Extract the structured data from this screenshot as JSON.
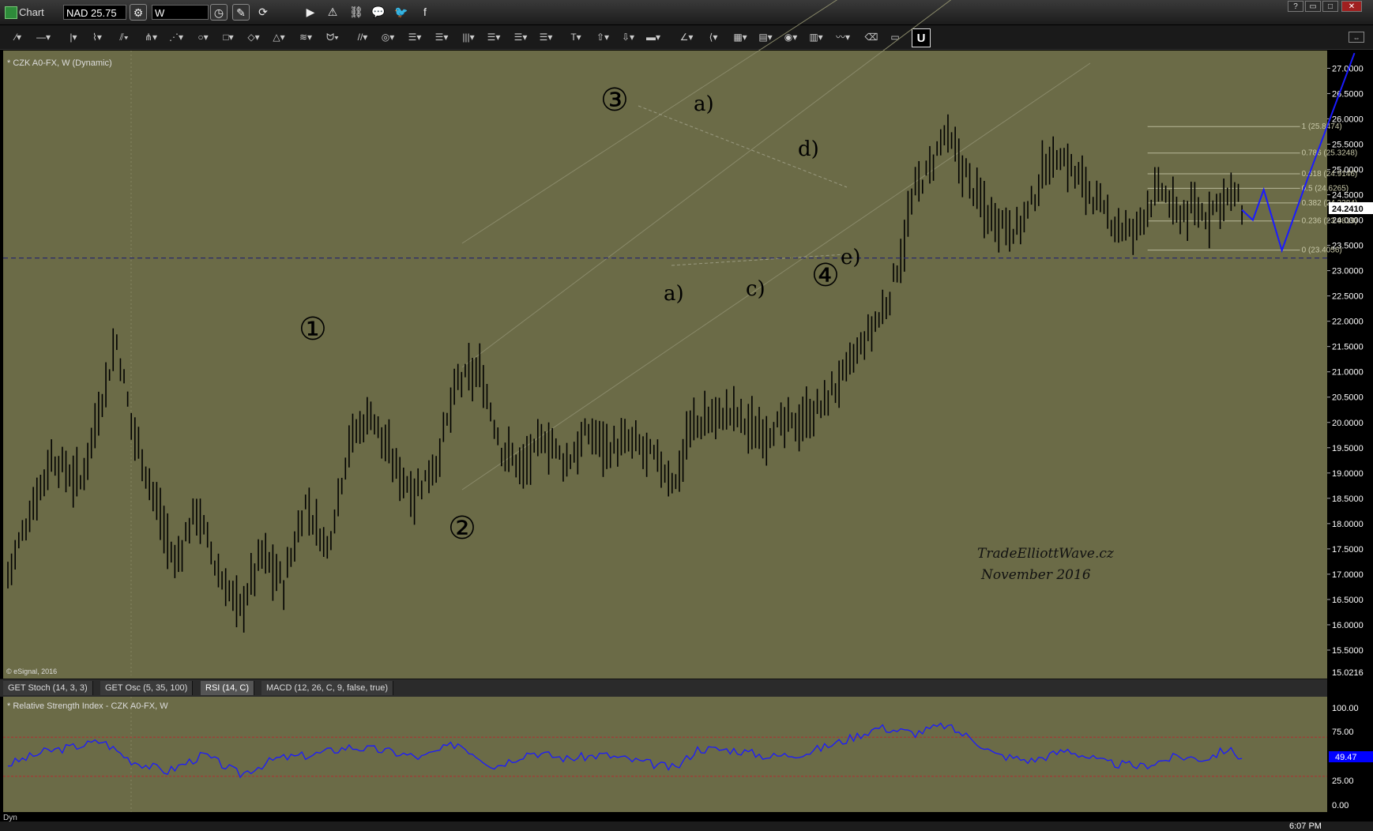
{
  "window": {
    "title": "Chart",
    "symbol": "NAD 25.75",
    "interval": "W",
    "buttons": [
      "?",
      "▭",
      "□",
      "✕"
    ]
  },
  "chart_header": "* CZK A0-FX, W (Dynamic)",
  "copyright": "© eSignal, 2016",
  "signature": [
    "TradeElliottWave.cz",
    "November  2016"
  ],
  "colors": {
    "background": "#6b6b47",
    "bars": "#000000",
    "projection": "#1a1aff",
    "dashed_line": "#2a2a6a",
    "rsi_line": "#1a1aff",
    "rsi_bounds": "#b03030",
    "price_badge": "#ffffff",
    "rsi_badge": "#0000ff"
  },
  "price_axis": {
    "ticks": [
      "27.0000",
      "26.5000",
      "26.0000",
      "25.5000",
      "25.0000",
      "24.5000",
      "24.0000",
      "23.5000",
      "23.0000",
      "22.5000",
      "22.0000",
      "21.5000",
      "21.0000",
      "20.5000",
      "20.0000",
      "19.5000",
      "19.0000",
      "18.5000",
      "18.0000",
      "17.5000",
      "17.0000",
      "16.5000",
      "16.0000",
      "15.5000"
    ],
    "last_price": "24.2410",
    "bottom_label": "15.0216"
  },
  "wave_labels": {
    "w1": "①",
    "w2": "②",
    "w3": "③",
    "w4": "④",
    "a_top": "a)",
    "d": "d)",
    "e": "e)",
    "a_bottom": "a)",
    "c": "c)"
  },
  "fib_levels": [
    {
      "ratio": "1",
      "value": "(25.8474)"
    },
    {
      "ratio": "0.786",
      "value": "(25.3248)"
    },
    {
      "ratio": "0.618",
      "value": "(24.9146)"
    },
    {
      "ratio": "0.5",
      "value": "(24.6265)"
    },
    {
      "ratio": "0.382",
      "value": "(24.3384)"
    },
    {
      "ratio": "0.236",
      "value": "(23.9819)"
    },
    {
      "ratio": "0",
      "value": "(23.4056)"
    }
  ],
  "tabs": [
    {
      "label": "GET Stoch (14, 3, 3)"
    },
    {
      "label": "GET Osc (5, 35, 100)"
    },
    {
      "label": "RSI (14, C)"
    },
    {
      "label": "MACD (12, 26, C, 9, false, true)"
    }
  ],
  "rsi_panel": {
    "title": "* Relative Strength Index - CZK A0-FX, W",
    "ticks": [
      "100.00",
      "75.00",
      "25.00",
      "0.00"
    ],
    "current": "49.47"
  },
  "status": {
    "dyn": "Dyn",
    "clock": "6:07 PM"
  },
  "chart_data": {
    "type": "candlestick",
    "title": "CZK A0-FX, W (Dynamic)",
    "yrange": [
      15.0216,
      27.3
    ],
    "anchors": [
      {
        "i": 0,
        "y": 17.0
      },
      {
        "i": 6,
        "y": 18.2
      },
      {
        "i": 12,
        "y": 19.3
      },
      {
        "i": 20,
        "y": 18.8
      },
      {
        "i": 26,
        "y": 20.5
      },
      {
        "i": 30,
        "y": 21.6
      },
      {
        "i": 34,
        "y": 20.0
      },
      {
        "i": 40,
        "y": 18.6
      },
      {
        "i": 46,
        "y": 17.2
      },
      {
        "i": 52,
        "y": 18.3
      },
      {
        "i": 58,
        "y": 17.0
      },
      {
        "i": 64,
        "y": 16.3
      },
      {
        "i": 70,
        "y": 17.4
      },
      {
        "i": 76,
        "y": 16.8
      },
      {
        "i": 82,
        "y": 18.4
      },
      {
        "i": 88,
        "y": 17.5
      },
      {
        "i": 94,
        "y": 19.6
      },
      {
        "i": 100,
        "y": 20.2
      },
      {
        "i": 106,
        "y": 19.2
      },
      {
        "i": 112,
        "y": 18.6
      },
      {
        "i": 118,
        "y": 19.2
      },
      {
        "i": 124,
        "y": 20.8
      },
      {
        "i": 130,
        "y": 21.0
      },
      {
        "i": 136,
        "y": 19.5
      },
      {
        "i": 142,
        "y": 19.1
      },
      {
        "i": 148,
        "y": 19.7
      },
      {
        "i": 154,
        "y": 19.2
      },
      {
        "i": 160,
        "y": 19.8
      },
      {
        "i": 166,
        "y": 19.5
      },
      {
        "i": 172,
        "y": 19.6
      },
      {
        "i": 178,
        "y": 19.3
      },
      {
        "i": 184,
        "y": 18.8
      },
      {
        "i": 188,
        "y": 19.9
      },
      {
        "i": 194,
        "y": 20.1
      },
      {
        "i": 200,
        "y": 20.2
      },
      {
        "i": 206,
        "y": 19.8
      },
      {
        "i": 212,
        "y": 19.9
      },
      {
        "i": 218,
        "y": 20.0
      },
      {
        "i": 224,
        "y": 20.3
      },
      {
        "i": 230,
        "y": 20.9
      },
      {
        "i": 236,
        "y": 21.6
      },
      {
        "i": 242,
        "y": 22.3
      },
      {
        "i": 246,
        "y": 23.3
      },
      {
        "i": 250,
        "y": 24.6
      },
      {
        "i": 254,
        "y": 25.0
      },
      {
        "i": 258,
        "y": 25.7
      },
      {
        "i": 262,
        "y": 25.2
      },
      {
        "i": 266,
        "y": 24.6
      },
      {
        "i": 270,
        "y": 24.1
      },
      {
        "i": 274,
        "y": 24.0
      },
      {
        "i": 278,
        "y": 23.8
      },
      {
        "i": 282,
        "y": 24.3
      },
      {
        "i": 286,
        "y": 25.1
      },
      {
        "i": 290,
        "y": 25.3
      },
      {
        "i": 294,
        "y": 24.9
      },
      {
        "i": 298,
        "y": 24.6
      },
      {
        "i": 302,
        "y": 24.1
      },
      {
        "i": 306,
        "y": 23.9
      },
      {
        "i": 310,
        "y": 23.7
      },
      {
        "i": 314,
        "y": 24.3
      },
      {
        "i": 318,
        "y": 24.6
      },
      {
        "i": 322,
        "y": 24.1
      },
      {
        "i": 326,
        "y": 24.2
      },
      {
        "i": 330,
        "y": 24.1
      },
      {
        "i": 334,
        "y": 24.4
      },
      {
        "i": 338,
        "y": 24.5
      },
      {
        "i": 340,
        "y": 24.2
      }
    ],
    "bar_count": 341,
    "projection": [
      {
        "i": 340,
        "y": 24.2
      },
      {
        "i": 343,
        "y": 24.0
      },
      {
        "i": 346,
        "y": 24.6
      },
      {
        "i": 351,
        "y": 23.4
      },
      {
        "i": 358,
        "y": 24.8
      },
      {
        "i": 371,
        "y": 27.3
      }
    ],
    "horizontal_level": 23.25,
    "rsi": {
      "ylim": [
        0,
        100
      ],
      "bounds": [
        70,
        30
      ],
      "anchors": [
        {
          "i": 0,
          "y": 42
        },
        {
          "i": 10,
          "y": 55
        },
        {
          "i": 18,
          "y": 60
        },
        {
          "i": 26,
          "y": 66
        },
        {
          "i": 34,
          "y": 46
        },
        {
          "i": 44,
          "y": 35
        },
        {
          "i": 54,
          "y": 52
        },
        {
          "i": 64,
          "y": 32
        },
        {
          "i": 74,
          "y": 48
        },
        {
          "i": 84,
          "y": 52
        },
        {
          "i": 94,
          "y": 60
        },
        {
          "i": 104,
          "y": 56
        },
        {
          "i": 114,
          "y": 49
        },
        {
          "i": 124,
          "y": 64
        },
        {
          "i": 134,
          "y": 40
        },
        {
          "i": 144,
          "y": 55
        },
        {
          "i": 154,
          "y": 48
        },
        {
          "i": 164,
          "y": 52
        },
        {
          "i": 174,
          "y": 45
        },
        {
          "i": 184,
          "y": 38
        },
        {
          "i": 190,
          "y": 58
        },
        {
          "i": 200,
          "y": 57
        },
        {
          "i": 210,
          "y": 50
        },
        {
          "i": 220,
          "y": 54
        },
        {
          "i": 230,
          "y": 66
        },
        {
          "i": 240,
          "y": 80
        },
        {
          "i": 250,
          "y": 74
        },
        {
          "i": 258,
          "y": 82
        },
        {
          "i": 266,
          "y": 68
        },
        {
          "i": 272,
          "y": 52
        },
        {
          "i": 282,
          "y": 46
        },
        {
          "i": 292,
          "y": 57
        },
        {
          "i": 302,
          "y": 44
        },
        {
          "i": 312,
          "y": 40
        },
        {
          "i": 322,
          "y": 50
        },
        {
          "i": 330,
          "y": 48
        },
        {
          "i": 336,
          "y": 58
        },
        {
          "i": 340,
          "y": 49
        }
      ]
    }
  }
}
